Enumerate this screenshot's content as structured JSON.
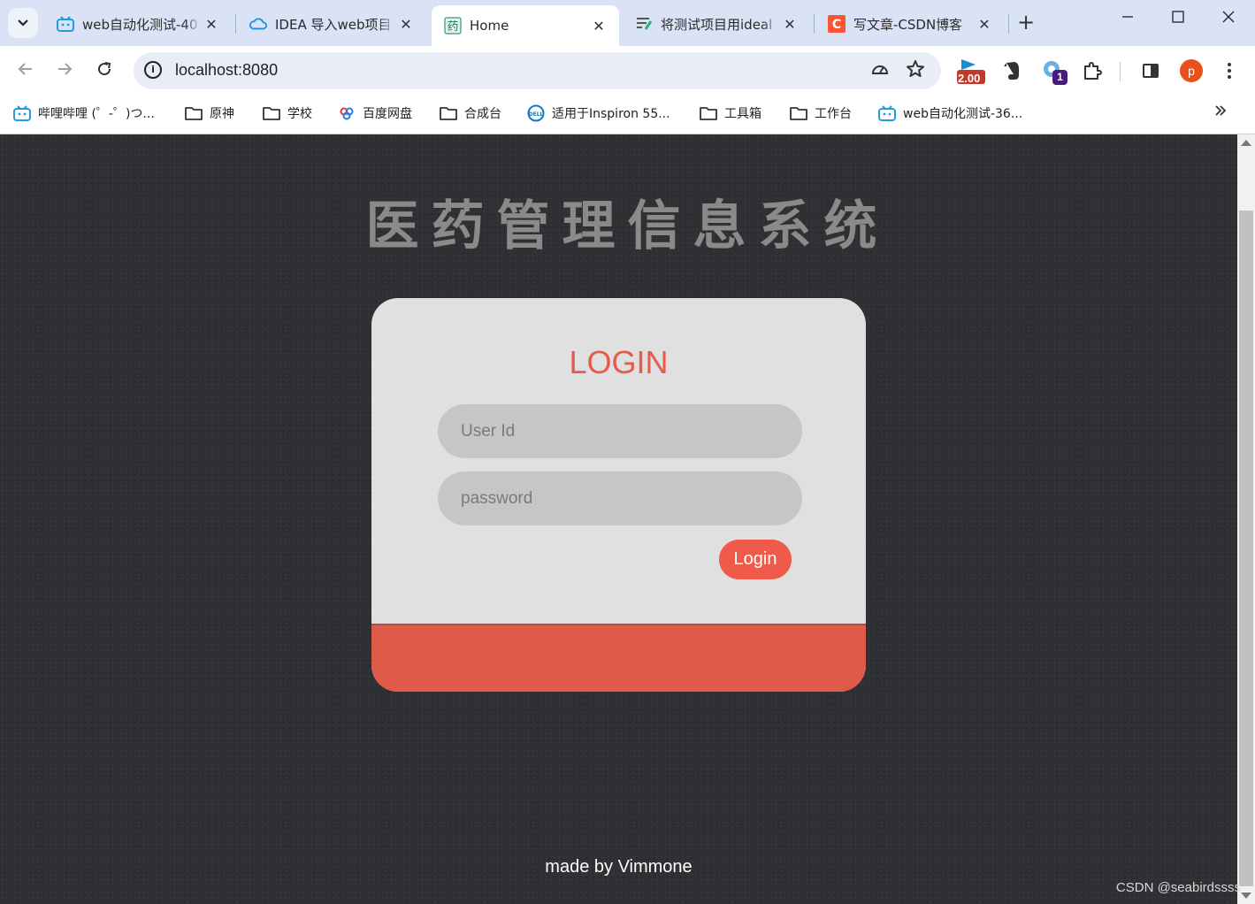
{
  "browser": {
    "tabs": [
      {
        "title": "web自动化测试-40",
        "favicon": "bilibili-icon",
        "active": false
      },
      {
        "title": "IDEA 导入web项目",
        "favicon": "cloud-icon",
        "active": false
      },
      {
        "title": "Home",
        "favicon": "medicine-icon",
        "active": true
      },
      {
        "title": "将测试项目用ideal",
        "favicon": "doc-icon",
        "active": false
      },
      {
        "title": "写文章-CSDN博客",
        "favicon": "csdn-icon",
        "active": false
      }
    ],
    "url": "localhost:8080",
    "extension_badge_speed": "2.00",
    "extension_badge_count": "1",
    "profile_initial": "p",
    "bookmarks": [
      {
        "label": "哔哩哔哩 (゜-゜)つ...",
        "icon": "bilibili-icon"
      },
      {
        "label": "原神",
        "icon": "folder-icon"
      },
      {
        "label": "学校",
        "icon": "folder-icon"
      },
      {
        "label": "百度网盘",
        "icon": "baidu-icon"
      },
      {
        "label": "合成台",
        "icon": "folder-icon"
      },
      {
        "label": "适用于Inspiron 55...",
        "icon": "dell-icon"
      },
      {
        "label": "工具箱",
        "icon": "folder-icon"
      },
      {
        "label": "工作台",
        "icon": "folder-icon"
      },
      {
        "label": "web自动化测试-36...",
        "icon": "bilibili-icon"
      }
    ]
  },
  "page": {
    "system_title": "医药管理信息系统",
    "login_heading": "LOGIN",
    "user_id_placeholder": "User Id",
    "password_placeholder": "password",
    "login_button": "Login",
    "footer_text": "made by Vimmone",
    "watermark": "CSDN @seabirdssss"
  },
  "colors": {
    "accent": "#e85a4a",
    "card_bg": "#e0e0e0",
    "page_bg": "#2f3033"
  }
}
